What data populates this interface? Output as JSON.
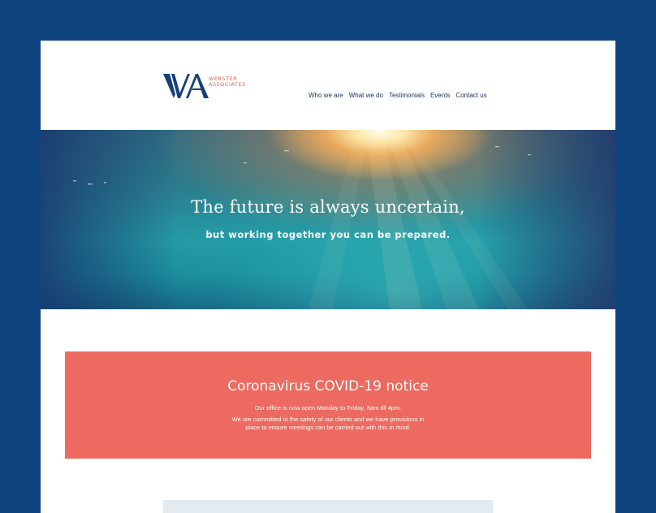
{
  "logo": {
    "monogram": "WA",
    "name_line1": "WEBSTER",
    "name_line2": "ASSOCIATES",
    "colors": {
      "monogram": "#173f7a",
      "name": "#d9624f"
    }
  },
  "nav": {
    "items": [
      "Who we are",
      "What we do",
      "Testimonials",
      "Events",
      "Contact us"
    ]
  },
  "hero": {
    "title": "The future is always uncertain,",
    "subtitle": "but working together you can be prepared."
  },
  "notice": {
    "title": "Coronavirus COVID-19 notice",
    "line1": "Our office is now open Monday to Friday, 8am till 4pm.",
    "line2": "We are committed to the safety of our clients and we have provisions in",
    "line3": "place to ensure meetings can be carried out with this in mind.",
    "color": "#ec6a5f"
  },
  "colors": {
    "background": "#0f447e",
    "nav_text": "#1b2f55"
  }
}
